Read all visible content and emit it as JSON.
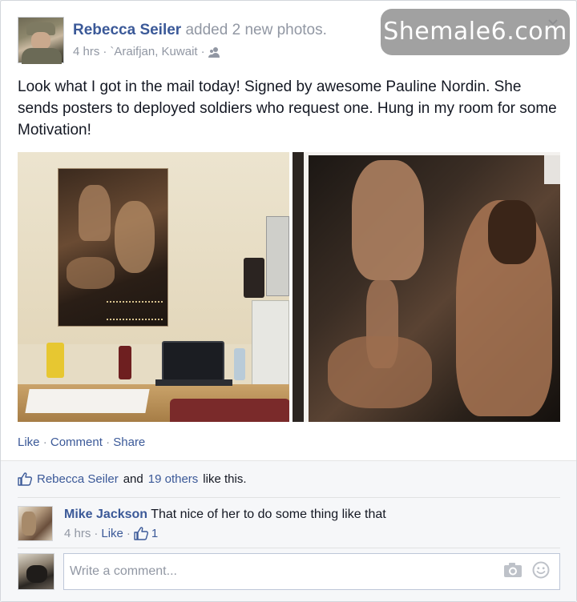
{
  "post": {
    "author": "Rebecca Seiler",
    "action": "added 2 new photos.",
    "time": "4 hrs",
    "location": "`Araifjan, Kuwait",
    "separator": "·",
    "audience_icon": "friends-icon",
    "menu_icon": "chevron-down-icon",
    "text": "Look what I got in the mail today! Signed by awesome Pauline Nordin. She sends posters to deployed soldiers who request one. Hung in my room for some Motivation!"
  },
  "watermark": "Shemale6.com",
  "actions": {
    "like": "Like",
    "comment": "Comment",
    "share": "Share",
    "separator": "·"
  },
  "likes": {
    "icon": "thumbs-up-icon",
    "name": "Rebecca Seiler",
    "and": "and",
    "others": "19 others",
    "suffix": "like this."
  },
  "comments": [
    {
      "author": "Mike Jackson",
      "text": "That nice of her to do some thing like that",
      "time": "4 hrs",
      "like_label": "Like",
      "like_count": "1",
      "separator": "·"
    }
  ],
  "composer": {
    "placeholder": "Write a comment...",
    "camera_icon": "camera-icon",
    "emoji_icon": "smiley-icon"
  },
  "colors": {
    "link": "#3b5998",
    "muted": "#9197a3",
    "text": "#141823",
    "feedback_bg": "#f6f7f9"
  }
}
